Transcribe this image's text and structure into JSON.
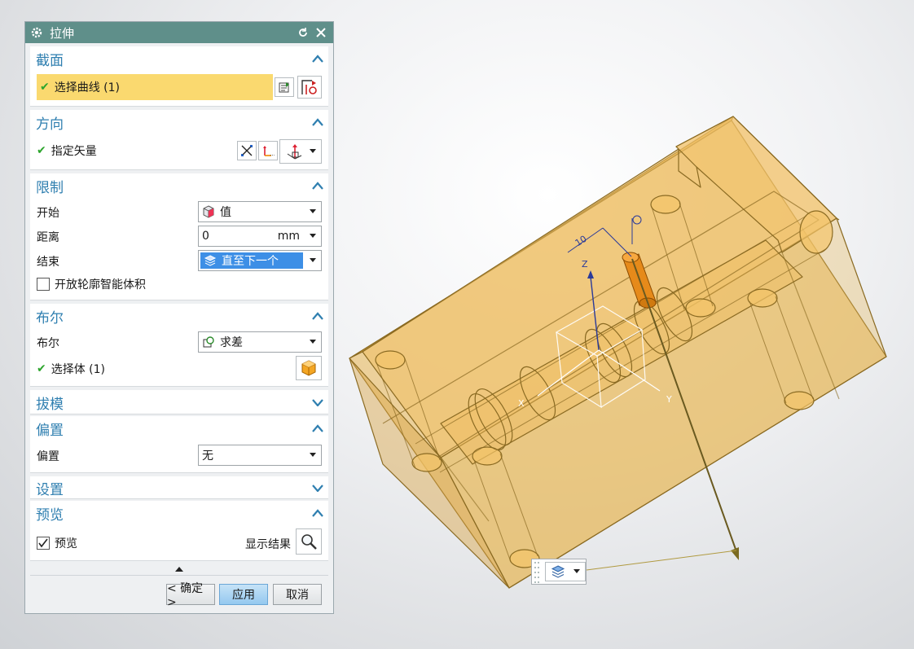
{
  "dialog": {
    "title": "拉伸",
    "icons": {
      "title": "gear-icon",
      "reset": "reset-icon",
      "close": "close-icon"
    }
  },
  "section": {
    "title": "截面",
    "select_curve": "选择曲线 (1)"
  },
  "direction": {
    "title": "方向",
    "specify_vector": "指定矢量"
  },
  "limits": {
    "title": "限制",
    "start_label": "开始",
    "start_value": "值",
    "distance_label": "距离",
    "distance_value": "0",
    "distance_unit": "mm",
    "end_label": "结束",
    "end_value": "直至下一个",
    "open_profile_label": "开放轮廓智能体积"
  },
  "boolean": {
    "title": "布尔",
    "boolean_label": "布尔",
    "boolean_value": "求差",
    "select_body": "选择体 (1)"
  },
  "draft": {
    "title": "拔模"
  },
  "offset": {
    "title": "偏置",
    "offset_label": "偏置",
    "offset_value": "无"
  },
  "settings": {
    "title": "设置"
  },
  "preview": {
    "title": "预览",
    "preview_label": "预览",
    "show_result": "显示结果"
  },
  "buttons": {
    "ok": "< 确定 >",
    "apply": "应用",
    "cancel": "取消"
  },
  "viewport": {
    "dim_label": "10",
    "axis_x": "X",
    "axis_y": "Y",
    "axis_z": "Z"
  },
  "colors": {
    "titlebar": "#5f8f8a",
    "section_title": "#2f7fb0",
    "highlight": "#fad96f",
    "selection": "#3d8fe6",
    "model_fill": "#e8b550",
    "model_edge": "#8a6a22"
  }
}
